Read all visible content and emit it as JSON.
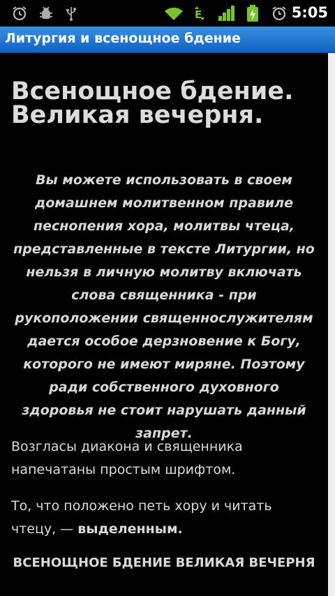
{
  "status_bar": {
    "time": "5:05",
    "icons": [
      "alarm-icon",
      "debug-icon",
      "usb-icon",
      "wifi-icon",
      "edge-data-icon",
      "signal-icon",
      "battery-icon",
      "clock-icon"
    ]
  },
  "app": {
    "title": "Литургия и всенощное бдение"
  },
  "content": {
    "heading_line1": "Всенощное бдение.",
    "heading_line2": "Великая вечерня.",
    "notice": "Вы можете использовать в своем домашнем молитвенном правиле песнопения хора, молитвы чтеца, представленные в тексте Литургии, но нельзя в личную молитву включать слова священника - при рукоположении священнослужителям дается особое дерзновение к Богу, которого не имеют миряне. Поэтому ради собственного духовного здоровья не стоит нарушать данный запрет.",
    "para1": "Возгласы диакона и священника напечатаны простым шрифтом.",
    "para2_text": "То, что положено петь хору и читать чтецу, —",
    "para2_bold": "выделенным.",
    "section_title": "ВСЕНОЩНОЕ БДЕНИЕ ВЕЛИКАЯ ВЕЧЕРНЯ"
  }
}
